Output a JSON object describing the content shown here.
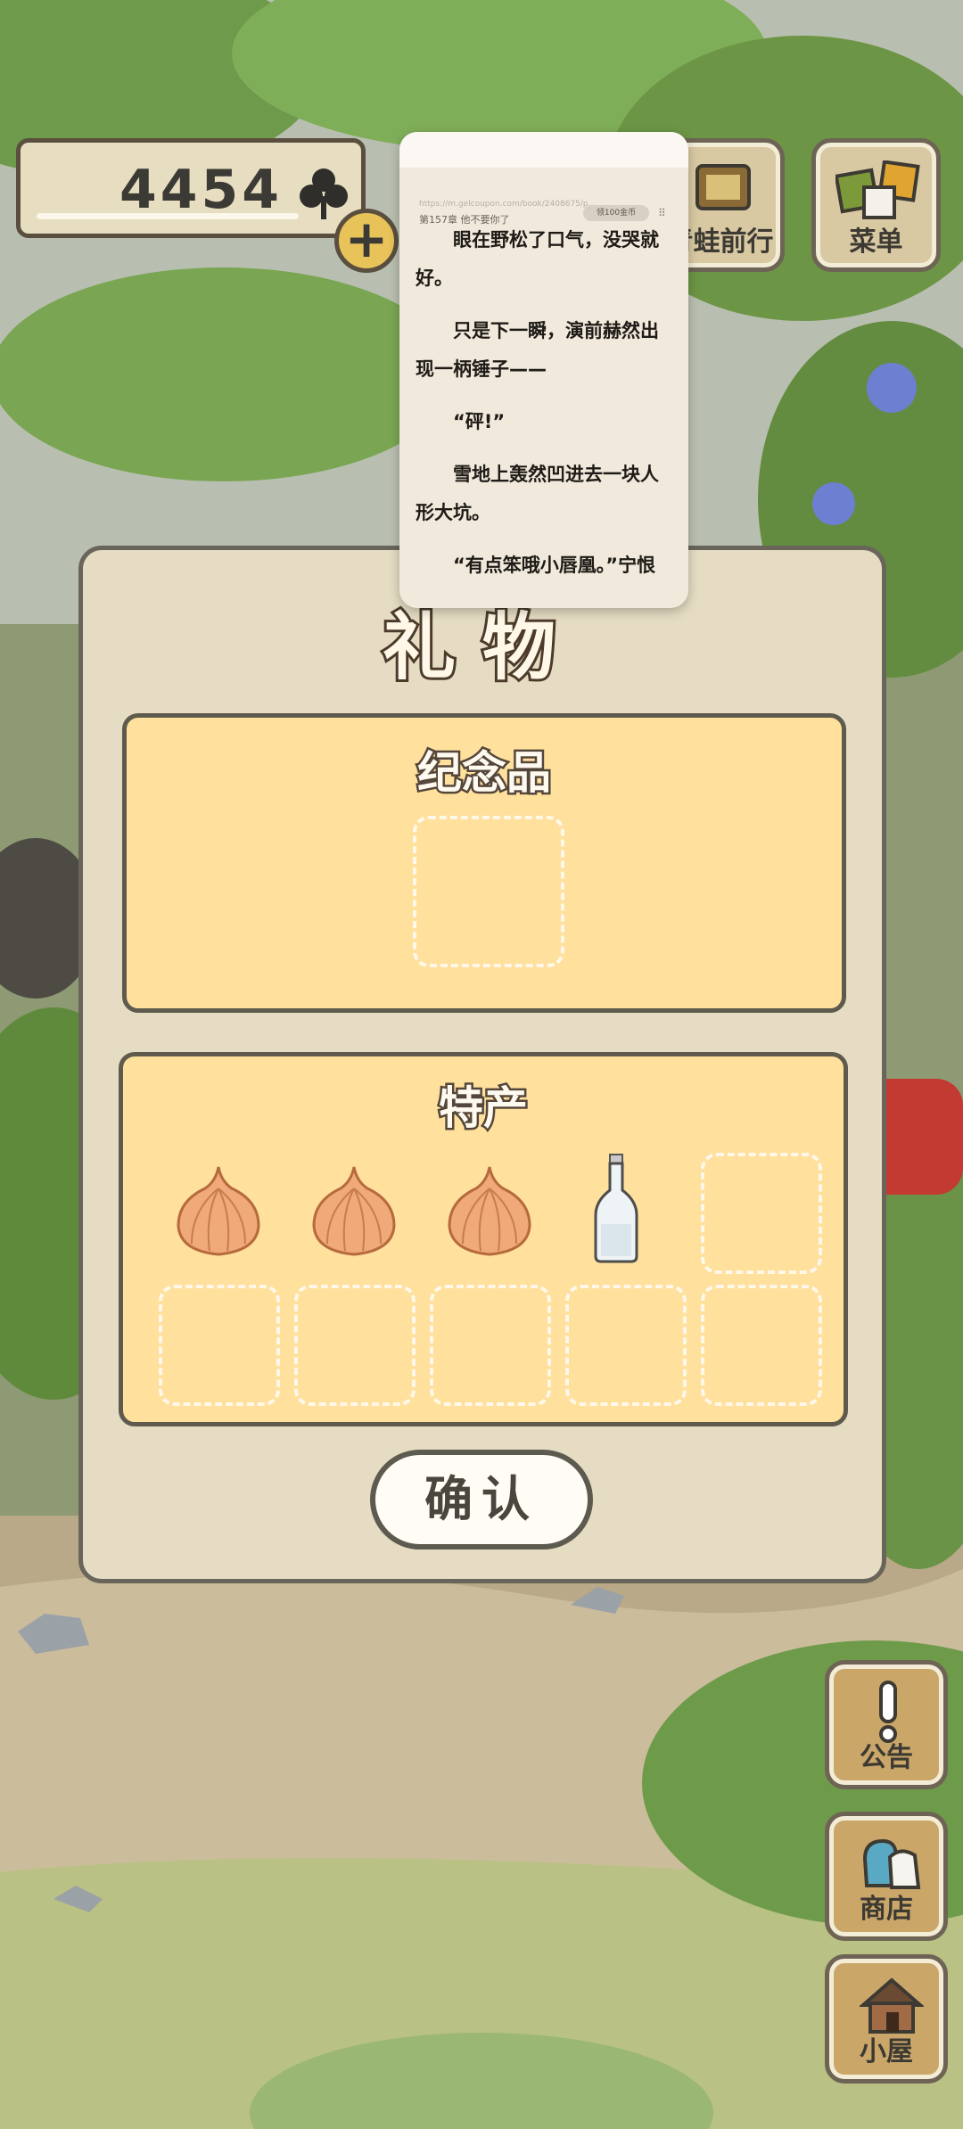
{
  "resources": {
    "clover_count": "4454",
    "plus_label": "+"
  },
  "top_buttons": {
    "travel_label": "青蛙前行",
    "menu_label": "菜单"
  },
  "side_buttons": {
    "notice_label": "公告",
    "shop_label": "商店",
    "house_label": "小屋"
  },
  "dialog": {
    "title": "礼物",
    "souvenir_title": "纪念品",
    "specialty_title": "特产",
    "specialty_items": [
      "onion",
      "onion",
      "onion",
      "glass-bottle"
    ],
    "confirm_label": "确认"
  },
  "reader": {
    "url": "https://m.gelcoupon.com/book/2408675/p...",
    "chapter": "第157章 他不要你了",
    "coin_badge": "领100金币",
    "paragraphs": [
      "眼在野松了口气，没哭就好。",
      "只是下一瞬，演前赫然出现一柄锤子——",
      "“砰!”",
      "雪地上轰然凹进去一块人形大坑。",
      "“有点笨哦小唇凰。”宁恨"
    ]
  },
  "colors": {
    "dialog_bg": "#e5dcc3",
    "section_bg": "#ffe09c",
    "outline": "#5f5a4e"
  }
}
